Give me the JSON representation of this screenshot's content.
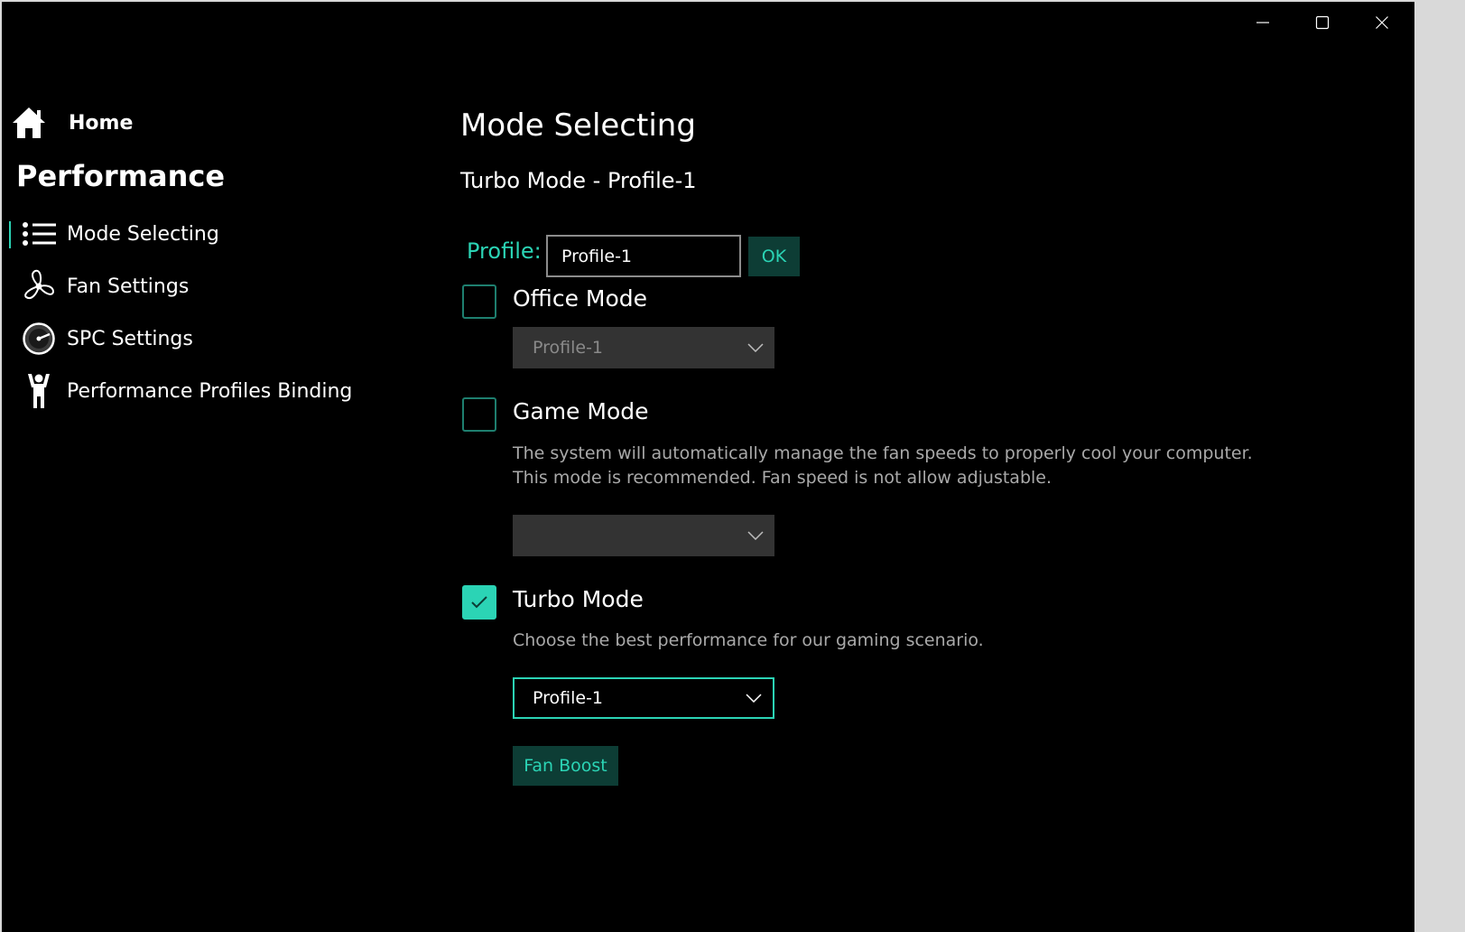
{
  "window": {
    "minimize_icon": "minimize-icon",
    "maximize_icon": "maximize-icon",
    "close_icon": "close-icon"
  },
  "sidebar": {
    "home_label": "Home",
    "section_title": "Performance",
    "items": [
      {
        "label": "Mode Selecting",
        "icon": "list-icon",
        "selected": true
      },
      {
        "label": "Fan Settings",
        "icon": "fan-icon",
        "selected": false
      },
      {
        "label": "SPC Settings",
        "icon": "gauge-icon",
        "selected": false
      },
      {
        "label": "Performance Profiles Binding",
        "icon": "person-icon",
        "selected": false
      }
    ]
  },
  "main": {
    "title": "Mode Selecting",
    "subtitle": "Turbo Mode - Profile-1",
    "profile_label": "Profile:",
    "profile_value": "Profile-1",
    "ok_label": "OK",
    "modes": [
      {
        "label": "Office Mode",
        "checked": false,
        "description": "",
        "dropdown_value": "Profile-1",
        "dropdown_enabled": false
      },
      {
        "label": "Game Mode",
        "checked": false,
        "description_line1": "The system will automatically manage the fan speeds to properly cool your computer.",
        "description_line2": "This mode is recommended. Fan speed is not allow adjustable.",
        "dropdown_value": "",
        "dropdown_enabled": false
      },
      {
        "label": "Turbo Mode",
        "checked": true,
        "description": "Choose the best performance for our gaming scenario.",
        "dropdown_value": "Profile-1",
        "dropdown_enabled": true
      }
    ],
    "fan_boost_label": "Fan Boost"
  },
  "colors": {
    "accent": "#2bd4b5",
    "accent_dark": "#0d3d35",
    "background": "#000000",
    "disabled_dropdown": "#333333"
  }
}
